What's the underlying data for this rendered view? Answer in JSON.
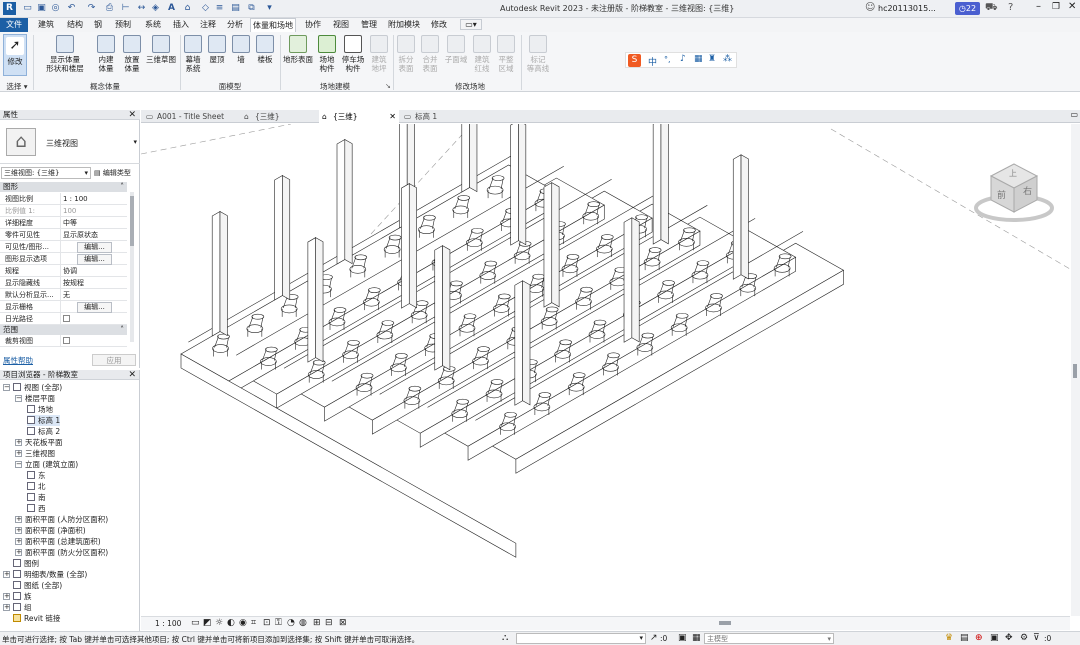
{
  "app": {
    "title": "Autodesk Revit 2023 - 未注册版 - 阶梯教室 - 三维视图: {三维}",
    "user": "hc20113015...",
    "notif_count": "22"
  },
  "ribbon": {
    "tabs": [
      "文件",
      "建筑",
      "结构",
      "钢",
      "预制",
      "系统",
      "插入",
      "注释",
      "分析",
      "体量和场地",
      "协作",
      "视图",
      "管理",
      "附加模块",
      "修改"
    ],
    "active_tab": "体量和场地",
    "buttons": {
      "modify": "修改",
      "show_mass": "显示体量\n形状和楼层",
      "in_place_mass": "内建\n体量",
      "place_mass": "放置\n体量",
      "3d_sketch": "三维草图",
      "curtain_system": "幕墙\n系统",
      "roof": "屋顶",
      "wall": "墙",
      "floor": "楼板",
      "toposurface": "地形表面",
      "site_component": "场地\n构件",
      "parking_component": "停车场\n构件",
      "building_pad": "建筑\n地坪",
      "split_surface": "拆分\n表面",
      "merge_surface": "合并\n表面",
      "subregion": "子面域",
      "property_line": "建筑\n红线",
      "graded_region": "平整\n区域",
      "label_contours": "标记\n等高线"
    },
    "groups": {
      "select": "选择 ▾",
      "conceptual_mass": "概念体量",
      "model_by_face": "面模型",
      "site_modeling": "场地建模",
      "modify_site": "修改场地"
    },
    "ime": "中"
  },
  "viewtabs": [
    {
      "label": "A001 - Title Sheet",
      "active": false
    },
    {
      "label": "{三维}",
      "active": false
    },
    {
      "label": "{三维}",
      "active": true
    },
    {
      "label": "标高 1",
      "active": false
    }
  ],
  "properties": {
    "title": "属性",
    "type_name": "三维视图",
    "view_selector": "三维视图: {三维}",
    "edit_type": "编辑类型",
    "sections": {
      "graphics": "图形",
      "extents": "范围"
    },
    "rows": [
      {
        "k": "视图比例",
        "v": "1 : 100",
        "kind": "text"
      },
      {
        "k": "比例值 1:",
        "v": "100",
        "kind": "dis"
      },
      {
        "k": "详细程度",
        "v": "中等",
        "kind": "text"
      },
      {
        "k": "零件可见性",
        "v": "显示原状态",
        "kind": "text"
      },
      {
        "k": "可见性/图形...",
        "v": "编辑...",
        "kind": "btn"
      },
      {
        "k": "图形显示选项",
        "v": "编辑...",
        "kind": "btn"
      },
      {
        "k": "规程",
        "v": "协调",
        "kind": "text"
      },
      {
        "k": "显示隐藏线",
        "v": "按规程",
        "kind": "text"
      },
      {
        "k": "默认分析显示...",
        "v": "无",
        "kind": "text"
      },
      {
        "k": "显示栅格",
        "v": "编辑...",
        "kind": "btn"
      },
      {
        "k": "日光路径",
        "v": "",
        "kind": "check"
      }
    ],
    "extents_rows": [
      {
        "k": "裁剪视图",
        "v": "",
        "kind": "check"
      }
    ],
    "help": "属性帮助",
    "apply": "应用"
  },
  "browser": {
    "title": "项目浏览器 - 阶梯教室",
    "nodes": [
      {
        "label": "视图 (全部)",
        "depth": 0,
        "exp": "−",
        "icon": "views"
      },
      {
        "label": "楼层平面",
        "depth": 1,
        "exp": "−"
      },
      {
        "label": "场地",
        "depth": 2,
        "exp": "",
        "icon": "view"
      },
      {
        "label": "标高 1",
        "depth": 2,
        "exp": "",
        "icon": "view",
        "sel": true
      },
      {
        "label": "标高 2",
        "depth": 2,
        "exp": "",
        "icon": "view"
      },
      {
        "label": "天花板平面",
        "depth": 1,
        "exp": "+"
      },
      {
        "label": "三维视图",
        "depth": 1,
        "exp": "+"
      },
      {
        "label": "立面 (建筑立面)",
        "depth": 1,
        "exp": "−"
      },
      {
        "label": "东",
        "depth": 2,
        "exp": "",
        "icon": "view"
      },
      {
        "label": "北",
        "depth": 2,
        "exp": "",
        "icon": "view"
      },
      {
        "label": "南",
        "depth": 2,
        "exp": "",
        "icon": "view"
      },
      {
        "label": "西",
        "depth": 2,
        "exp": "",
        "icon": "view"
      },
      {
        "label": "面积平面 (人防分区面积)",
        "depth": 1,
        "exp": "+"
      },
      {
        "label": "面积平面 (净面积)",
        "depth": 1,
        "exp": "+"
      },
      {
        "label": "面积平面 (总建筑面积)",
        "depth": 1,
        "exp": "+"
      },
      {
        "label": "面积平面 (防火分区面积)",
        "depth": 1,
        "exp": "+"
      },
      {
        "label": "图例",
        "depth": 0,
        "exp": "",
        "icon": "legend"
      },
      {
        "label": "明细表/数量 (全部)",
        "depth": 0,
        "exp": "+",
        "icon": "sched"
      },
      {
        "label": "图纸 (全部)",
        "depth": 0,
        "exp": "",
        "icon": "sheet"
      },
      {
        "label": "族",
        "depth": 0,
        "exp": "+",
        "icon": "fam"
      },
      {
        "label": "组",
        "depth": 0,
        "exp": "+",
        "icon": "grp"
      },
      {
        "label": "Revit 链接",
        "depth": 0,
        "exp": "",
        "icon": "link"
      }
    ]
  },
  "viewcube": {
    "top": "上",
    "front": "前",
    "right": "右"
  },
  "viewcontrol": {
    "scale": "1 : 100"
  },
  "status": {
    "message": "单击可进行选择; 按 Tab 键并单击可选择其他项目; 按 Ctrl 键并单击可将新项目添加到选择集; 按 Shift 键并单击可取消选择。",
    "count": ":0",
    "model": "主模型",
    "filter": ":0"
  },
  "colors": {
    "accent": "#1c5fa5",
    "ribbon": "#f5f6f8",
    "panel": "#e8eaed"
  }
}
